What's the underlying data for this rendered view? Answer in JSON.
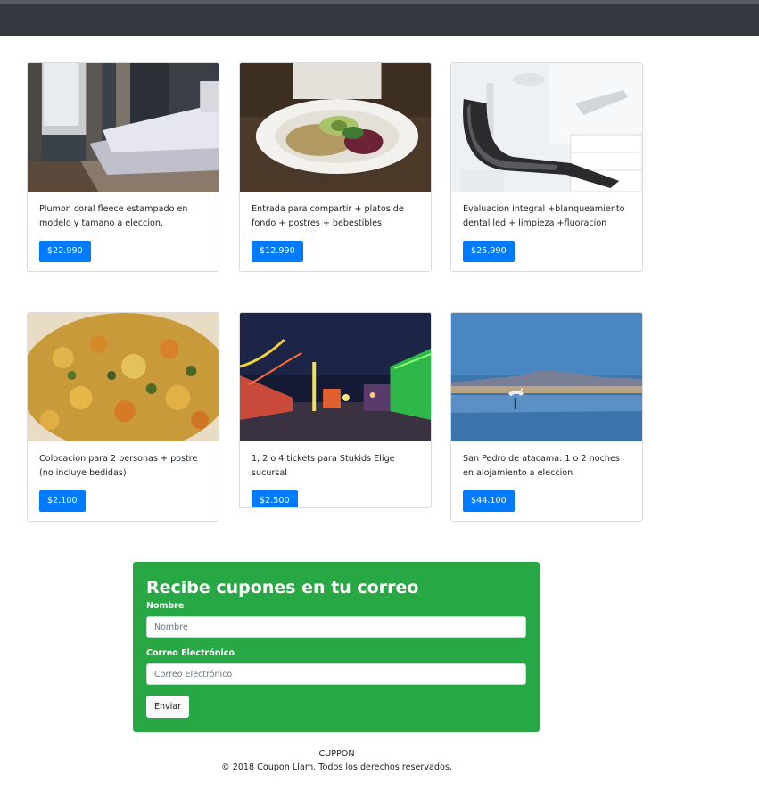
{
  "deals": [
    {
      "title": "Plumon coral fleece estampado en modelo y tamano a eleccion.",
      "price": "$22.990",
      "image": "bedroom photo"
    },
    {
      "title": "Entrada para compartir + platos de fondo + postres + bebestibles",
      "price": "$12.990",
      "image": "salad plate photo"
    },
    {
      "title": "Evaluacion integral +blanqueamiento dental led + limpieza +fluoracion",
      "price": "$25.990",
      "image": "dental chair photo"
    },
    {
      "title": "Colocacion para 2 personas + postre (no incluye bedidas)",
      "price": "$2.100",
      "image": "stew food photo"
    },
    {
      "title": "1, 2 o 4 tickets para Stukids Elige sucursal",
      "price": "$2.500",
      "image": "amusement park night photo"
    },
    {
      "title": "San Pedro de atacama: 1 o 2 noches en alojamiento a eleccion",
      "price": "$44.100",
      "image": "flamingo lagoon photo"
    }
  ],
  "newsletter": {
    "title": "Recibe cupones en tu correo",
    "name_label": "Nombre",
    "name_placeholder": "Nombre",
    "email_label": "Correo Electrónico",
    "email_placeholder": "Correo Electrónico",
    "submit_label": "Enviar"
  },
  "footer": {
    "brand": "CUPPON",
    "copyright": "© 2018 Coupon Llam. Todos los derechos reservados."
  },
  "colors": {
    "navbar": "#343a40",
    "price_button": "#007bff",
    "newsletter_bg": "#28a745"
  }
}
